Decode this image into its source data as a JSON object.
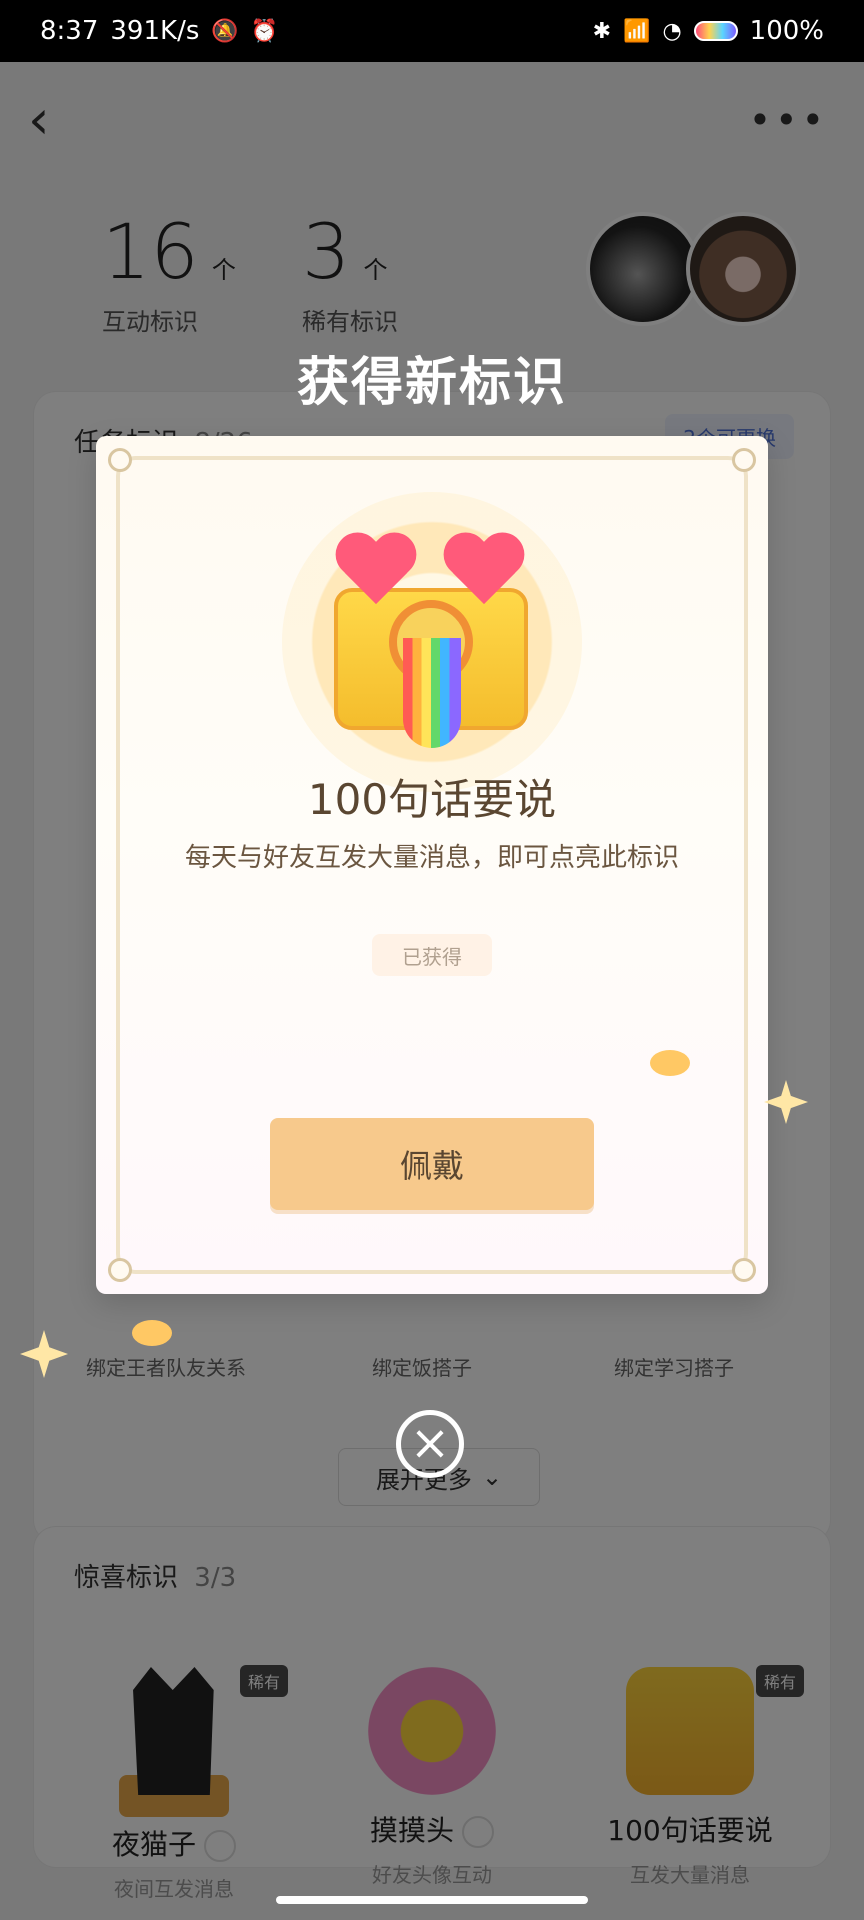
{
  "status_bar": {
    "time": "8:37",
    "network_speed": "391K/s",
    "battery_percent": "100%"
  },
  "header": {
    "stats": [
      {
        "value": "16",
        "unit": "个",
        "label": "互动标识"
      },
      {
        "value": "3",
        "unit": "个",
        "label": "稀有标识"
      }
    ]
  },
  "sections": {
    "tasks": {
      "title": "任务标识",
      "count": "8/26",
      "action": "2个可更换",
      "bottom_labels": [
        "绑定王者队友关系",
        "绑定饭搭子",
        "绑定学习搭子"
      ],
      "expand_label": "展开更多"
    },
    "surprise": {
      "title": "惊喜标识",
      "count": "3/3",
      "badges": [
        {
          "name": "夜猫子",
          "desc": "夜间互发消息",
          "tag": "稀有"
        },
        {
          "name": "摸摸头",
          "desc": "好友头像互动",
          "tag": ""
        },
        {
          "name": "100句话要说",
          "desc": "互发大量消息",
          "tag": "稀有"
        }
      ]
    }
  },
  "popup": {
    "heading": "获得新标识",
    "badge_title": "100句话要说",
    "description": "每天与好友互发大量消息，即可点亮此标识",
    "status": "已获得",
    "button_label": "佩戴"
  },
  "icons": {
    "back": "chevron-left-icon",
    "more": "more-icon",
    "close": "close-icon",
    "expand": "chevron-down-icon"
  }
}
